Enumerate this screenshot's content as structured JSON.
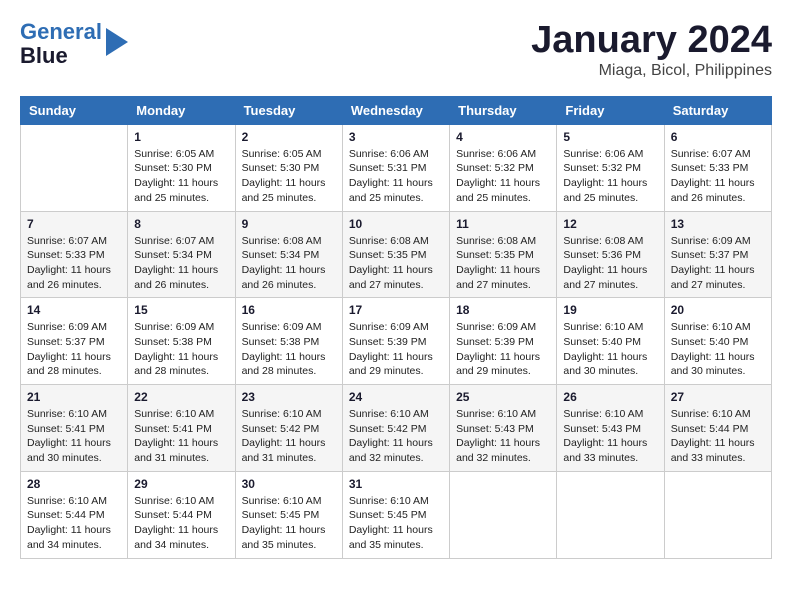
{
  "header": {
    "logo_line1": "General",
    "logo_line2": "Blue",
    "month_title": "January 2024",
    "location": "Miaga, Bicol, Philippines"
  },
  "weekdays": [
    "Sunday",
    "Monday",
    "Tuesday",
    "Wednesday",
    "Thursday",
    "Friday",
    "Saturday"
  ],
  "weeks": [
    [
      {
        "day": null
      },
      {
        "day": "1",
        "sunrise": "6:05 AM",
        "sunset": "5:30 PM",
        "daylight": "11 hours and 25 minutes."
      },
      {
        "day": "2",
        "sunrise": "6:05 AM",
        "sunset": "5:30 PM",
        "daylight": "11 hours and 25 minutes."
      },
      {
        "day": "3",
        "sunrise": "6:06 AM",
        "sunset": "5:31 PM",
        "daylight": "11 hours and 25 minutes."
      },
      {
        "day": "4",
        "sunrise": "6:06 AM",
        "sunset": "5:32 PM",
        "daylight": "11 hours and 25 minutes."
      },
      {
        "day": "5",
        "sunrise": "6:06 AM",
        "sunset": "5:32 PM",
        "daylight": "11 hours and 25 minutes."
      },
      {
        "day": "6",
        "sunrise": "6:07 AM",
        "sunset": "5:33 PM",
        "daylight": "11 hours and 26 minutes."
      }
    ],
    [
      {
        "day": "7",
        "sunrise": "6:07 AM",
        "sunset": "5:33 PM",
        "daylight": "11 hours and 26 minutes."
      },
      {
        "day": "8",
        "sunrise": "6:07 AM",
        "sunset": "5:34 PM",
        "daylight": "11 hours and 26 minutes."
      },
      {
        "day": "9",
        "sunrise": "6:08 AM",
        "sunset": "5:34 PM",
        "daylight": "11 hours and 26 minutes."
      },
      {
        "day": "10",
        "sunrise": "6:08 AM",
        "sunset": "5:35 PM",
        "daylight": "11 hours and 27 minutes."
      },
      {
        "day": "11",
        "sunrise": "6:08 AM",
        "sunset": "5:35 PM",
        "daylight": "11 hours and 27 minutes."
      },
      {
        "day": "12",
        "sunrise": "6:08 AM",
        "sunset": "5:36 PM",
        "daylight": "11 hours and 27 minutes."
      },
      {
        "day": "13",
        "sunrise": "6:09 AM",
        "sunset": "5:37 PM",
        "daylight": "11 hours and 27 minutes."
      }
    ],
    [
      {
        "day": "14",
        "sunrise": "6:09 AM",
        "sunset": "5:37 PM",
        "daylight": "11 hours and 28 minutes."
      },
      {
        "day": "15",
        "sunrise": "6:09 AM",
        "sunset": "5:38 PM",
        "daylight": "11 hours and 28 minutes."
      },
      {
        "day": "16",
        "sunrise": "6:09 AM",
        "sunset": "5:38 PM",
        "daylight": "11 hours and 28 minutes."
      },
      {
        "day": "17",
        "sunrise": "6:09 AM",
        "sunset": "5:39 PM",
        "daylight": "11 hours and 29 minutes."
      },
      {
        "day": "18",
        "sunrise": "6:09 AM",
        "sunset": "5:39 PM",
        "daylight": "11 hours and 29 minutes."
      },
      {
        "day": "19",
        "sunrise": "6:10 AM",
        "sunset": "5:40 PM",
        "daylight": "11 hours and 30 minutes."
      },
      {
        "day": "20",
        "sunrise": "6:10 AM",
        "sunset": "5:40 PM",
        "daylight": "11 hours and 30 minutes."
      }
    ],
    [
      {
        "day": "21",
        "sunrise": "6:10 AM",
        "sunset": "5:41 PM",
        "daylight": "11 hours and 30 minutes."
      },
      {
        "day": "22",
        "sunrise": "6:10 AM",
        "sunset": "5:41 PM",
        "daylight": "11 hours and 31 minutes."
      },
      {
        "day": "23",
        "sunrise": "6:10 AM",
        "sunset": "5:42 PM",
        "daylight": "11 hours and 31 minutes."
      },
      {
        "day": "24",
        "sunrise": "6:10 AM",
        "sunset": "5:42 PM",
        "daylight": "11 hours and 32 minutes."
      },
      {
        "day": "25",
        "sunrise": "6:10 AM",
        "sunset": "5:43 PM",
        "daylight": "11 hours and 32 minutes."
      },
      {
        "day": "26",
        "sunrise": "6:10 AM",
        "sunset": "5:43 PM",
        "daylight": "11 hours and 33 minutes."
      },
      {
        "day": "27",
        "sunrise": "6:10 AM",
        "sunset": "5:44 PM",
        "daylight": "11 hours and 33 minutes."
      }
    ],
    [
      {
        "day": "28",
        "sunrise": "6:10 AM",
        "sunset": "5:44 PM",
        "daylight": "11 hours and 34 minutes."
      },
      {
        "day": "29",
        "sunrise": "6:10 AM",
        "sunset": "5:44 PM",
        "daylight": "11 hours and 34 minutes."
      },
      {
        "day": "30",
        "sunrise": "6:10 AM",
        "sunset": "5:45 PM",
        "daylight": "11 hours and 35 minutes."
      },
      {
        "day": "31",
        "sunrise": "6:10 AM",
        "sunset": "5:45 PM",
        "daylight": "11 hours and 35 minutes."
      },
      {
        "day": null
      },
      {
        "day": null
      },
      {
        "day": null
      }
    ]
  ]
}
